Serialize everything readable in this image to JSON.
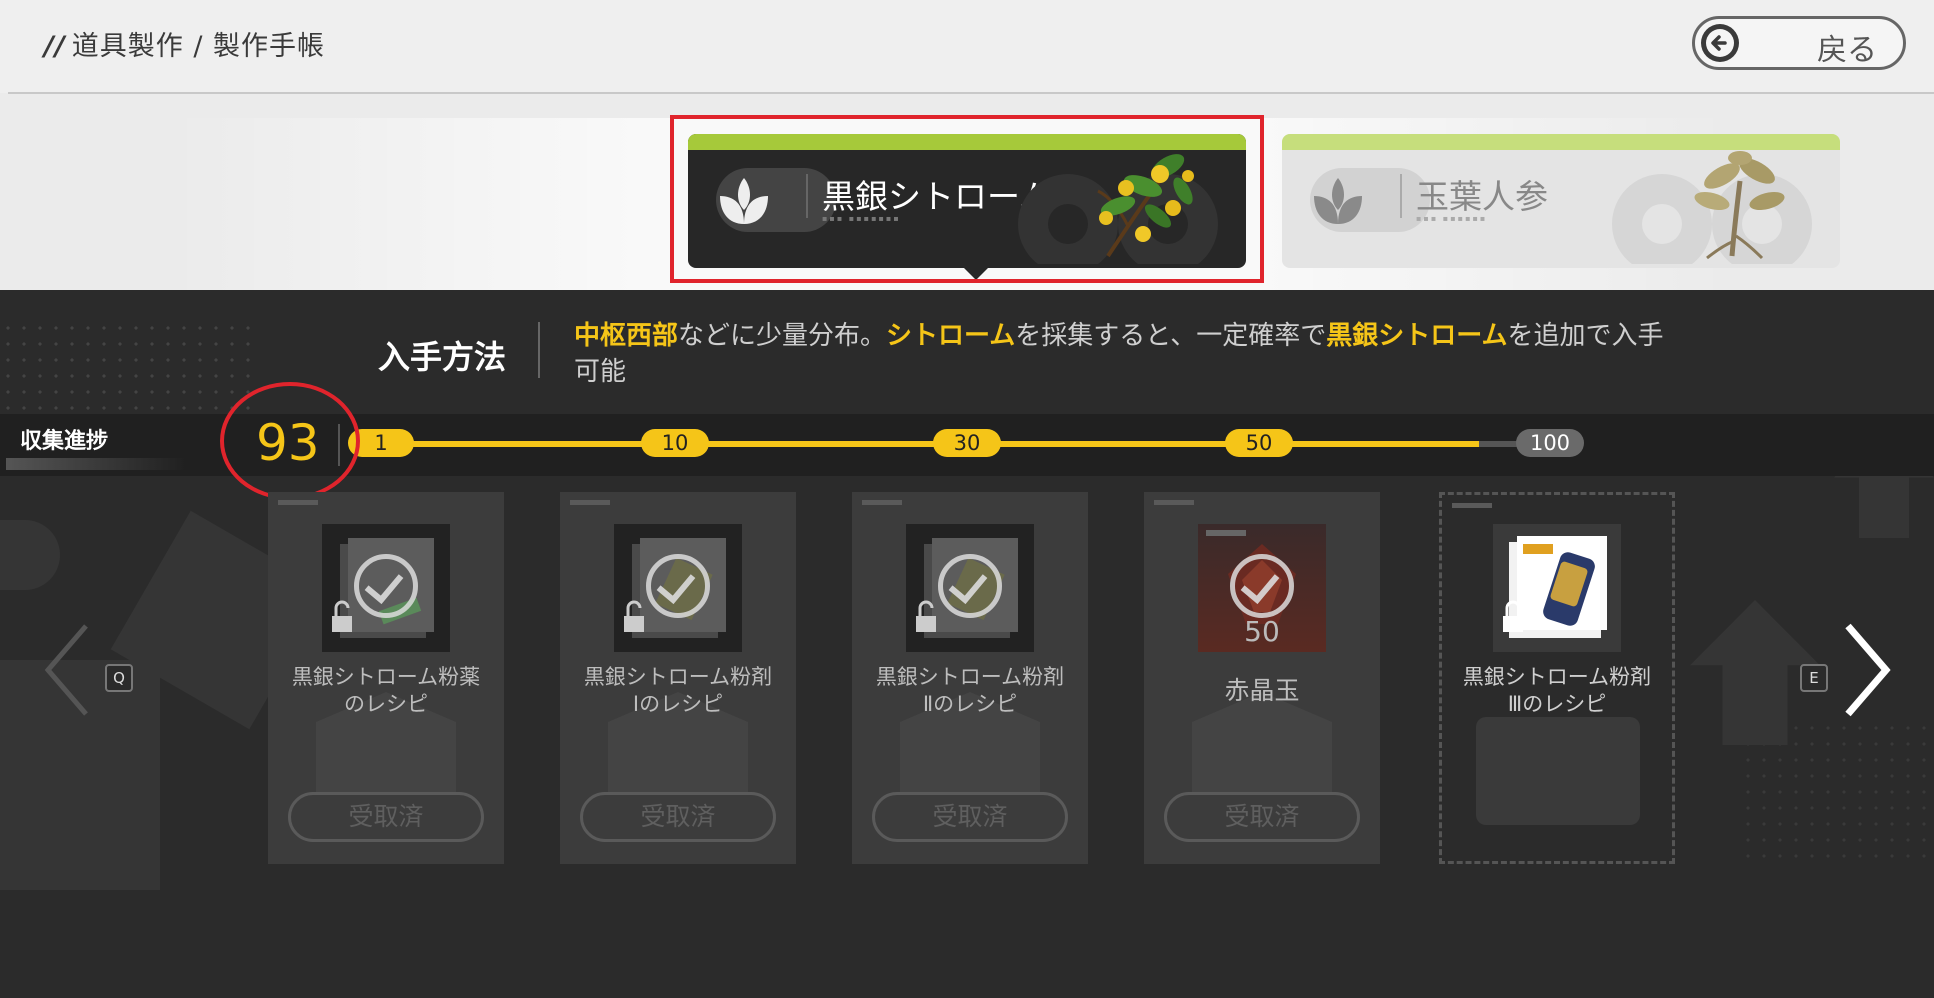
{
  "header": {
    "breadcrumb": "道具製作 / 製作手帳",
    "back_label": "戻る"
  },
  "items": [
    {
      "name": "黒銀シトローム",
      "subtitle": "▪▪▪ ▪▪▪▪▪▪▪",
      "selected": true
    },
    {
      "name": "玉葉人参",
      "subtitle": "▪▪▪ ▪▪▪▪▪▪",
      "selected": false
    }
  ],
  "acquisition": {
    "label": "入手方法",
    "parts": [
      {
        "text": "中枢西部",
        "highlight": true
      },
      {
        "text": "などに少量分布。",
        "highlight": false
      },
      {
        "text": "シトローム",
        "highlight": true
      },
      {
        "text": "を採集すると、一定確率で",
        "highlight": false
      },
      {
        "text": "黒銀シトローム",
        "highlight": true
      },
      {
        "text": "を追加で入手可能",
        "highlight": false
      }
    ]
  },
  "progress": {
    "label": "収集進捗",
    "count": "93",
    "current": 93,
    "max": 100,
    "milestones": [
      "1",
      "10",
      "30",
      "50",
      "100"
    ]
  },
  "rewards": [
    {
      "name": "黒銀シトローム粉薬\nのレシピ",
      "button": "受取済",
      "claimed": true
    },
    {
      "name": "黒銀シトローム粉剤\nⅠのレシピ",
      "button": "受取済",
      "claimed": true
    },
    {
      "name": "黒銀シトローム粉剤\nⅡのレシピ",
      "button": "受取済",
      "claimed": true
    },
    {
      "name": "赤晶玉",
      "button": "受取済",
      "claimed": true,
      "quantity": "50"
    },
    {
      "name": "黒銀シトローム粉剤\nⅢのレシピ",
      "button": "",
      "claimed": false
    }
  ],
  "nav": {
    "prev_key": "Q",
    "next_key": "E"
  },
  "colors": {
    "accent": "#f5c518",
    "strip": "#a6c93a",
    "highlight": "#e0242c"
  }
}
